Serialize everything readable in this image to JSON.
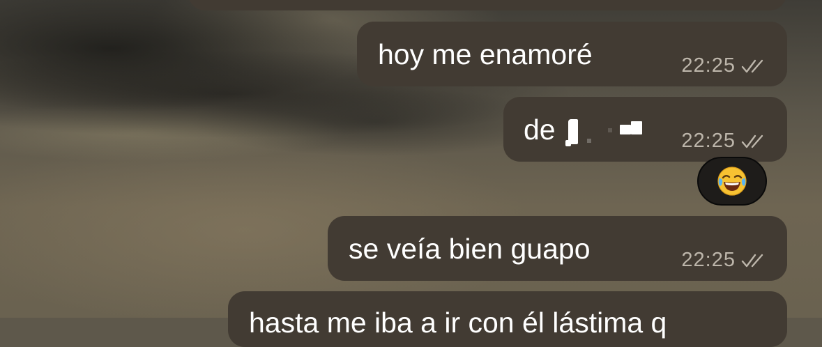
{
  "chat": {
    "messages": [
      {
        "text": "hoy me enamoré",
        "time": "22:25",
        "status": "read-double-check"
      },
      {
        "text": "de",
        "time": "22:25",
        "status": "read-double-check",
        "redacted_name": true
      },
      {
        "text": "se veía bien guapo",
        "time": "22:25",
        "status": "read-double-check"
      },
      {
        "text": "hasta me iba a ir con él lástima q",
        "time": "",
        "status": ""
      }
    ],
    "reaction": {
      "emoji": "😂",
      "icon": "tears-of-joy-emoji-icon"
    }
  },
  "colors": {
    "bubble": "#423b33",
    "text": "#ffffff",
    "meta": "#bdb6ab"
  }
}
